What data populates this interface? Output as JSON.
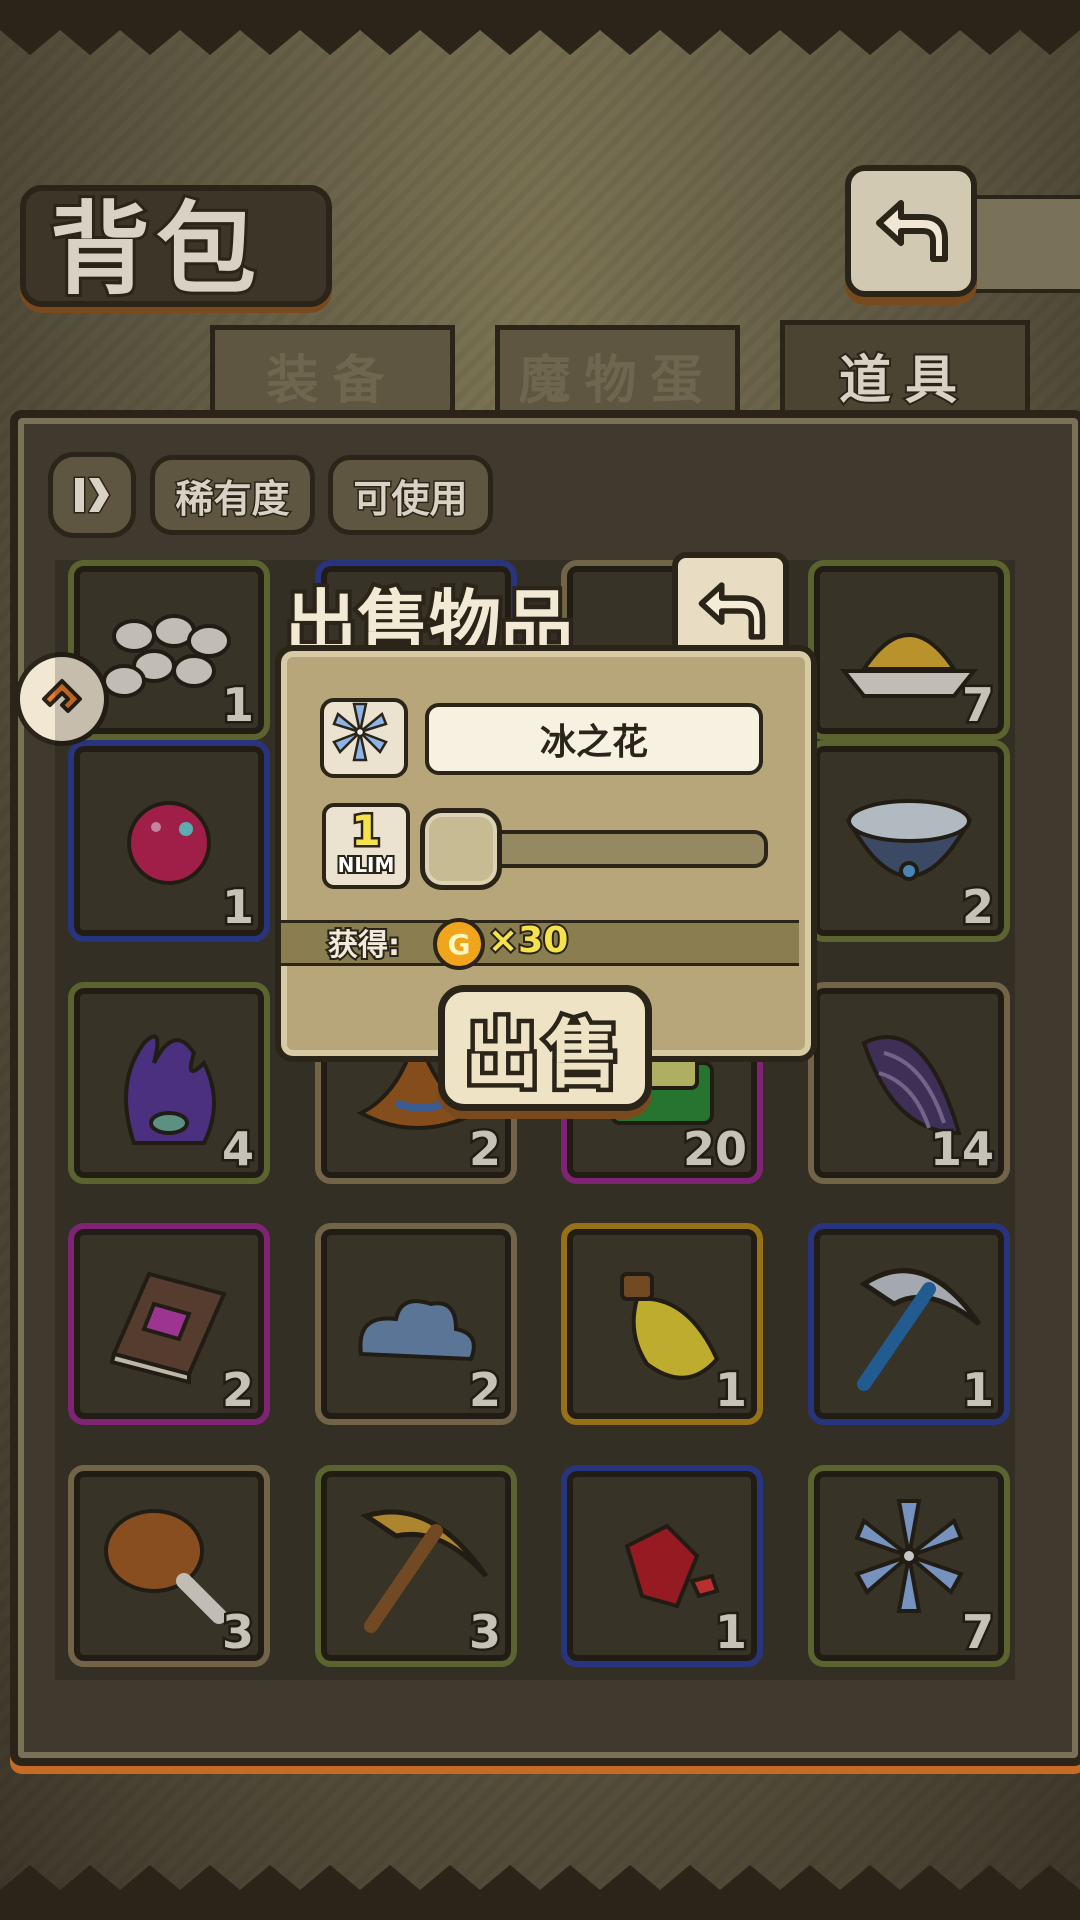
{
  "header": {
    "title": "背包",
    "back_icon": "return-arrow-icon"
  },
  "tabs": [
    {
      "label": "装备",
      "active": false
    },
    {
      "label": "魔物蛋",
      "active": false
    },
    {
      "label": "道具",
      "active": true
    }
  ],
  "filters": {
    "sort_icon": "sort-toggle-icon",
    "rarity_label": "稀有度",
    "usable_label": "可使用"
  },
  "side_button_icon": "arrow-badge-icon",
  "grid": [
    {
      "item": "eggs",
      "qty": "1",
      "rarity": "green"
    },
    {
      "item": "unknown",
      "qty": "",
      "rarity": "blue"
    },
    {
      "item": "unknown",
      "qty": "",
      "rarity": "brown"
    },
    {
      "item": "rice-plate",
      "qty": "7",
      "rarity": "green"
    },
    {
      "item": "pink-orb",
      "qty": "1",
      "rarity": "blue"
    },
    {
      "item": "unknown",
      "qty": "",
      "rarity": "green"
    },
    {
      "item": "unknown",
      "qty": "",
      "rarity": "green"
    },
    {
      "item": "paw-bowl",
      "qty": "2",
      "rarity": "green"
    },
    {
      "item": "purple-tentacle-monster",
      "qty": "4",
      "rarity": "green"
    },
    {
      "item": "witch-hat",
      "qty": "2",
      "rarity": "brown"
    },
    {
      "item": "green-tablet",
      "qty": "20",
      "rarity": "purple"
    },
    {
      "item": "dark-seed",
      "qty": "14",
      "rarity": "brown"
    },
    {
      "item": "magic-book",
      "qty": "2",
      "rarity": "purple"
    },
    {
      "item": "blue-cloud",
      "qty": "2",
      "rarity": "brown"
    },
    {
      "item": "yellow-potion",
      "qty": "1",
      "rarity": "gold"
    },
    {
      "item": "iron-pickaxe",
      "qty": "1",
      "rarity": "blue"
    },
    {
      "item": "chicken-leg",
      "qty": "3",
      "rarity": "brown"
    },
    {
      "item": "wood-pickaxe",
      "qty": "3",
      "rarity": "green"
    },
    {
      "item": "red-crystal",
      "qty": "1",
      "rarity": "blue"
    },
    {
      "item": "ice-flower",
      "qty": "7",
      "rarity": "green"
    }
  ],
  "sell_dialog": {
    "title": "出售物品",
    "back_icon": "return-arrow-icon",
    "item_icon": "ice-flower-icon",
    "item_name": "冰之花",
    "quantity": "1",
    "quantity_label": "NLIM",
    "slider_fraction": 0.0,
    "gain_label": "获得:",
    "coin_symbol": "G",
    "gain_amount": "×30",
    "sell_label": "出售"
  },
  "colors": {
    "rarity_green": "#6f7b3a",
    "rarity_blue": "#33409a",
    "rarity_purple": "#9b2c8e",
    "rarity_gold": "#b88a1c",
    "rarity_brown": "#8a7a5a",
    "accent_orange": "#c76a26",
    "gold_text": "#f6e24a"
  }
}
